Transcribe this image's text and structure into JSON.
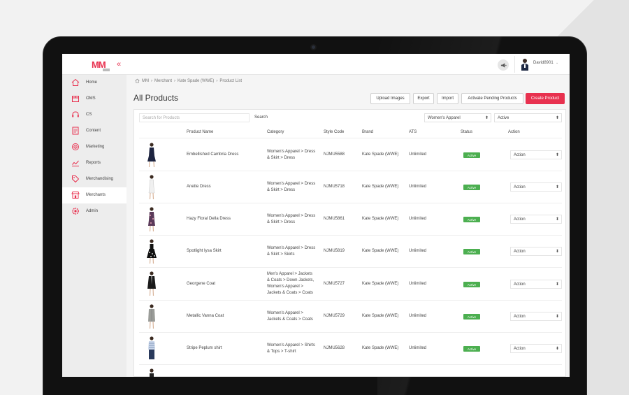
{
  "topbar": {
    "logo_text": "MM",
    "collapse_icon": "«",
    "username": "David8901",
    "user_caret": "⌄"
  },
  "sidebar": {
    "items": [
      {
        "label": "Home",
        "icon": "home-icon"
      },
      {
        "label": "OMS",
        "icon": "box-icon"
      },
      {
        "label": "CS",
        "icon": "headset-icon"
      },
      {
        "label": "Content",
        "icon": "document-icon"
      },
      {
        "label": "Marketing",
        "icon": "target-icon"
      },
      {
        "label": "Reports",
        "icon": "chart-icon"
      },
      {
        "label": "Merchandising",
        "icon": "tag-icon"
      },
      {
        "label": "Merchants",
        "icon": "store-icon"
      },
      {
        "label": "Admin",
        "icon": "gear-icon"
      }
    ],
    "active_index": 7
  },
  "breadcrumb": {
    "items": [
      "MM",
      "Merchant",
      "Kate Spade (WWE)",
      "Product List"
    ],
    "separator": "›"
  },
  "page": {
    "title": "All Products"
  },
  "toolbar": {
    "upload_images": "Upload Images",
    "export": "Export",
    "import": "Import",
    "activate_pending": "Activate Pending Products",
    "create_product": "Create Product"
  },
  "filters": {
    "search_placeholder": "Search for Products",
    "search_label": "Search",
    "category_value": "Women's Apparel",
    "status_value": "Active"
  },
  "table": {
    "columns": [
      "Product Name",
      "Category",
      "Style Code",
      "Brand",
      "ATS",
      "Status",
      "Action"
    ],
    "rows": [
      {
        "name": "Embellished Cambria Dress",
        "category": [
          "Women's Apparel > Dress",
          "& Skirt > Dress"
        ],
        "style": "NJMU5588",
        "brand": "Kate Spade (WWE)",
        "ats": "Unlimited",
        "status": "Active",
        "action": "Action"
      },
      {
        "name": "Anette Dress",
        "category": [
          "Women's Apparel > Dress",
          "& Skirt > Dress"
        ],
        "style": "NJMU5718",
        "brand": "Kate Spade (WWE)",
        "ats": "Unlimited",
        "status": "Active",
        "action": "Action"
      },
      {
        "name": "Hazy Floral Della Dress",
        "category": [
          "Women's Apparel > Dress",
          "& Skirt > Dress"
        ],
        "style": "NJMU5861",
        "brand": "Kate Spade (WWE)",
        "ats": "Unlimited",
        "status": "Active",
        "action": "Action"
      },
      {
        "name": "Spotlight Iysa Skirt",
        "category": [
          "Women's Apparel > Dress",
          "& Skirt > Skirts"
        ],
        "style": "NJMU5819",
        "brand": "Kate Spade (WWE)",
        "ats": "Unlimited",
        "status": "Active",
        "action": "Action"
      },
      {
        "name": "Georgene Coat",
        "category": [
          "Men's Apparel > Jackets",
          "& Coats > Down Jackets,",
          "Women's Apparel >",
          "Jackets & Coats > Coats"
        ],
        "style": "NJMU5727",
        "brand": "Kate Spade (WWE)",
        "ats": "Unlimited",
        "status": "Active",
        "action": "Action"
      },
      {
        "name": "Metallic Vanna Coat",
        "category": [
          "Women's Apparel >",
          "Jackets & Coats > Coats"
        ],
        "style": "NJMU5729",
        "brand": "Kate Spade (WWE)",
        "ats": "Unlimited",
        "status": "Active",
        "action": "Action"
      },
      {
        "name": "Stripe Peplum shirt",
        "category": [
          "Women's Apparel > Shirts",
          "& Tops > T-shirt"
        ],
        "style": "NJMU5628",
        "brand": "Kate Spade (WWE)",
        "ats": "Unlimited",
        "status": "Active",
        "action": "Action"
      }
    ]
  },
  "colors": {
    "accent": "#e8314f",
    "status_active": "#4caf50"
  }
}
